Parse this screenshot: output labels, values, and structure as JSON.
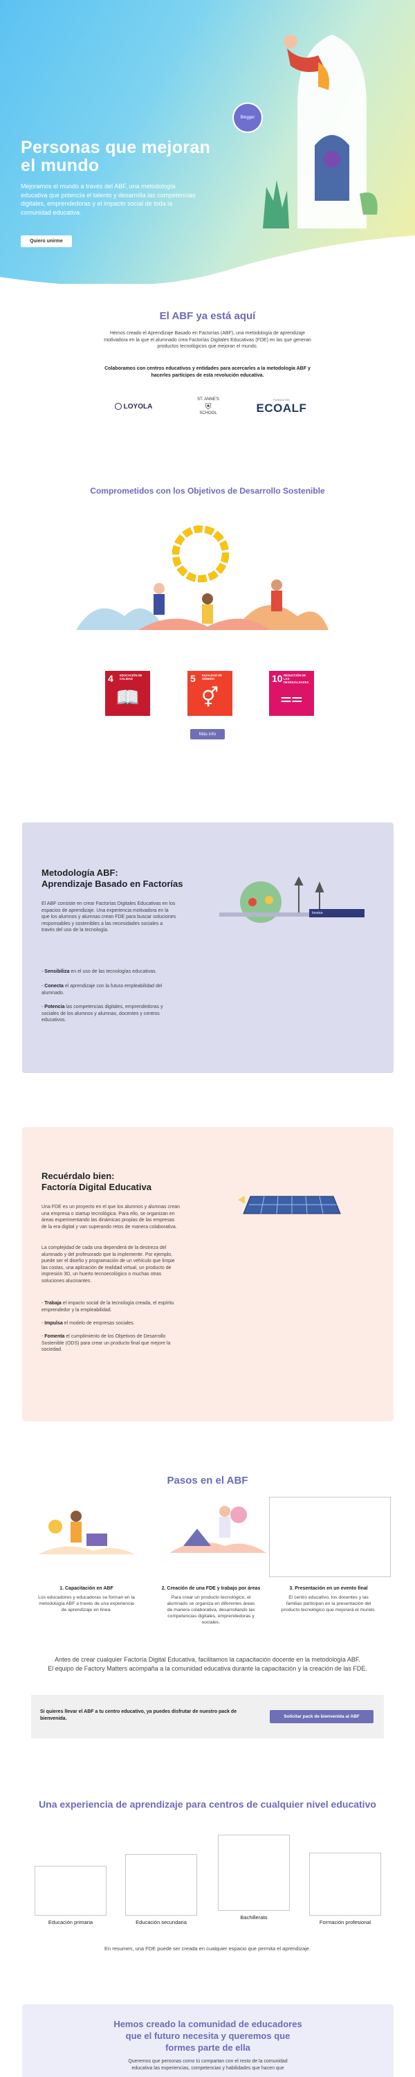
{
  "hero": {
    "title": "Personas que mejoran el mundo",
    "text": "Mejoramos el mundo a través del ABF, una metodología educativa que potencia el talento y desarrolla las competencias digitales, emprendedoras y el impacto social de toda la comunidad educativa.",
    "button": "Quiero unirme",
    "bubble": "Blogger"
  },
  "abf_intro": {
    "title": "El ABF ya está aquí",
    "text": "Hemos creado el Aprendizaje Basado en Factorías (ABF), una metodología de aprendizaje motivadora en la que el alumnado crea Factorías Digitales Educativas (FDE) en las que generan productos tecnológicos que mejoran el mundo.",
    "partners_text": "Colaboramos con centros educativos y entidades para acercarles a la metodología ABF y hacerles partícipes de esta revolución educativa.",
    "logos": {
      "loyola": "LOYOLA",
      "staa_top": "ST. ANNE'S",
      "staa_bottom": "SCHOOL",
      "ecoalf_top": "FUNDACIÓN",
      "ecoalf": "ECOALF"
    }
  },
  "ods": {
    "title": "Comprometidos con los Objetivos de Desarrollo Sostenible",
    "cards": [
      {
        "num": "4",
        "label": "EDUCACIÓN DE CALIDAD",
        "glyph": "📖",
        "color": "#c5192d"
      },
      {
        "num": "5",
        "label": "IGUALDAD DE GÉNERO",
        "glyph": "⚥",
        "color": "#ef402b"
      },
      {
        "num": "10",
        "label": "REDUCCIÓN DE LAS DESIGUALDADES",
        "glyph": "⩵",
        "color": "#dd1367"
      }
    ],
    "more_button": "Más info"
  },
  "methodology": {
    "title_line1": "Metodología ABF:",
    "title_line2": "Aprendizaje Basado en Factorías",
    "p1": "El ABF consiste en crear Factorías Digitales Educativas en los espacios de aprendizaje. Una experiencia motivadora en la que los alumnos y alumnas crean FDE para buscar soluciones responsables y sostenibles a las necesidades sociales a través del uso de la tecnología.",
    "b1_bold": "Sensibiliza",
    "b1_rest": " en el uso de las tecnologías educativas.",
    "b2_bold": "Conecta",
    "b2_rest": " el aprendizaje con la futura empleabilidad del alumnado.",
    "b3_bold": "Potencia",
    "b3_rest": " las competencias digitales, emprendedoras y sociales de los alumnos y alumnas, docentes y centros educativos.",
    "screen_label": "Invoice"
  },
  "fde": {
    "title_line1": "Recuérdalo bien:",
    "title_line2": "Factoría Digital Educativa",
    "p1": "Una FDE es un proyecto en el que los alumnos y alumnas crean una empresa o startup tecnológica. Para ello, se organizan en áreas experimentando las dinámicas propias de las empresas de la era digital y van superando retos de manera colaborativa.",
    "p2": "La complejidad de cada una dependerá de la destreza del alumnado y del profesorado que la implemente. Por ejemplo, puede ser el diseño y programación de un vehículo que limpie las costas, una aplicación de realidad virtual, un producto de impresión 3D, un huerto tecnoecológico o muchas otras soluciones alucinantes.",
    "b1_bold": "Trabaja",
    "b1_rest": " el impacto social de la tecnología creada, el espíritu emprendedor y la empleabilidad.",
    "b2_bold": "Impulsa",
    "b2_rest": " el modelo de empresas sociales.",
    "b3_bold": "Fomenta",
    "b3_rest": " el cumplimiento de los Objetivos de Desarrollo Sostenible (ODS) para crear un producto final que mejore la sociedad."
  },
  "steps": {
    "title": "Pasos en el ABF",
    "items": [
      {
        "title": "1. Capacitación en ABF",
        "text": "Los educadores y educadoras se forman en la metodología ABF a través de una experiencia de aprendizaje en línea."
      },
      {
        "title": "2. Creación de una FDE y trabajo por áreas",
        "text": "Para crear un producto tecnológico, el alumnado se organiza en diferentes áreas de manera colaborativa, desarrollando las competencias digitales, emprendedoras y sociales."
      },
      {
        "title": "3. Presentación en un evento final",
        "text": "El centro educativo, los docentes y las familias participan en la presentación del producto tecnológico que mejorará el mundo."
      }
    ],
    "note_line1": "Antes de crear cualquier Factoría Digital Educativa, facilitamos la capacitación docente en la metodología ABF.",
    "note_line2": "El equipo de Factory Matters acompaña a la comunidad educativa durante la capacitación y la creación de las FDE.",
    "pack_text": "Si quieres llevar el ABF a tu centro educativo, ya puedes disfrutar de nuestro pack de bienvenida.",
    "pack_button": "Solicitar pack de bienvenida al ABF"
  },
  "levels": {
    "title": "Una experiencia de aprendizaje para centros de cualquier nivel educativo",
    "items": [
      "Educación primaria",
      "Educación secundaria",
      "Bachillerato",
      "Formación profesional"
    ],
    "summary": "En resumen, una FDE puede ser creada en cualquier espacio que permita el aprendizaje."
  },
  "community": {
    "title": "Hemos creado la comunidad de educadores que el futuro necesita y queremos que formes parte de ella",
    "text": "Queremos que personas como tú compartan con el resto de la comunidad educativa las experiencias, competencias y habilidades que hacen que"
  }
}
